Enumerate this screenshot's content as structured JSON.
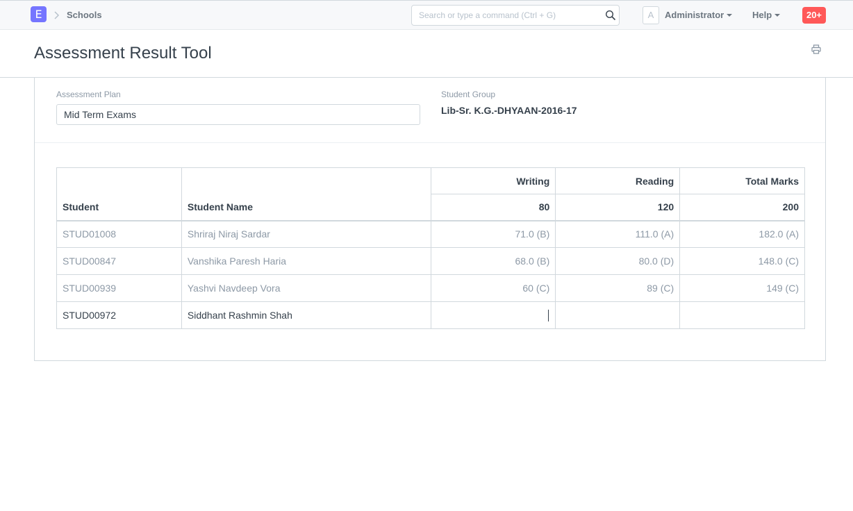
{
  "navbar": {
    "logo_letter": "E",
    "breadcrumb": "Schools",
    "search_placeholder": "Search or type a command (Ctrl + G)",
    "avatar_letter": "A",
    "user_label": "Administrator",
    "help_label": "Help",
    "notifications": "20+"
  },
  "page": {
    "title": "Assessment Result Tool"
  },
  "form": {
    "assessment_plan_label": "Assessment Plan",
    "assessment_plan_value": "Mid Term Exams",
    "student_group_label": "Student Group",
    "student_group_value": "Lib-Sr. K.G.-DHYAAN-2016-17"
  },
  "table": {
    "headers": {
      "student": "Student",
      "student_name": "Student Name",
      "writing": "Writing",
      "reading": "Reading",
      "total": "Total Marks"
    },
    "max_scores": {
      "writing": "80",
      "reading": "120",
      "total": "200"
    },
    "rows": [
      {
        "student": "STUD01008",
        "name": "Shriraj Niraj Sardar",
        "writing": "71.0 (B)",
        "reading": "111.0 (A)",
        "total": "182.0 (A)"
      },
      {
        "student": "STUD00847",
        "name": "Vanshika Paresh Haria",
        "writing": "68.0 (B)",
        "reading": "80.0 (D)",
        "total": "148.0 (C)"
      },
      {
        "student": "STUD00939",
        "name": "Yashvi Navdeep Vora",
        "writing": "60 (C)",
        "reading": "89 (C)",
        "total": "149 (C)"
      },
      {
        "student": "STUD00972",
        "name": "Siddhant Rashmin Shah",
        "writing": "",
        "reading": "",
        "total": ""
      }
    ]
  },
  "icons": {
    "search": "search-icon",
    "print": "print-icon",
    "breadcrumb_separator": "chevron-right-icon"
  },
  "colors": {
    "brand": "#7575ff",
    "notification": "#ff5858",
    "muted_text": "#8d99a6",
    "border": "#d1d8dd"
  }
}
